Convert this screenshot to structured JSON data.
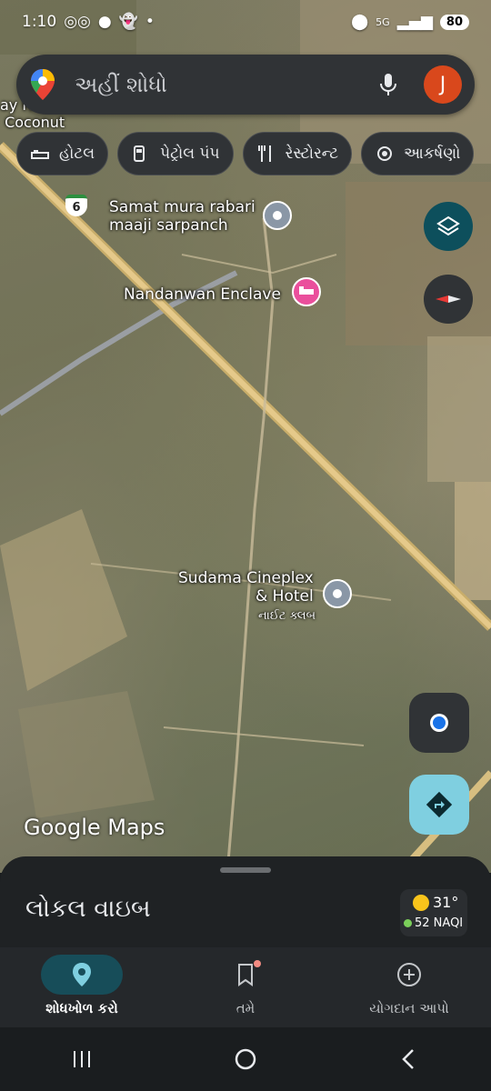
{
  "status_bar": {
    "time": "1:10",
    "battery": "80",
    "network": "5G"
  },
  "search": {
    "placeholder": "અહીં શોધો",
    "avatar_letter": "J"
  },
  "chips": [
    {
      "label": "હોટલ",
      "icon": "bed-icon"
    },
    {
      "label": "પેટ્રોલ પંપ",
      "icon": "fuel-icon"
    },
    {
      "label": "રેસ્ટોરન્ટ",
      "icon": "restaurant-icon"
    },
    {
      "label": "આકર્ષણો",
      "icon": "attraction-icon"
    }
  ],
  "map": {
    "places": [
      {
        "name": "Samat mura rabari\nmaaji sarpanch"
      },
      {
        "name": "Nandanwan Enclave"
      },
      {
        "name": "Sudama Cineplex\n& Hotel",
        "sub": "નાઈટ ક્લબ"
      }
    ],
    "road_badge": "6",
    "edge_label": "ay H\n Coconut",
    "logo": "Google Maps"
  },
  "sheet": {
    "title": "લોકલ વાઇબ",
    "temperature": "31°",
    "aqi": "52 NAQI"
  },
  "bottom_nav": [
    {
      "label": "શોધખોળ કરો",
      "active": true
    },
    {
      "label": "તમે",
      "active": false
    },
    {
      "label": "યોગદાન આપો",
      "active": false
    }
  ],
  "colors": {
    "accent": "#7fcfe0",
    "avatar": "#d9481c",
    "layers_button": "#0d4f5c"
  }
}
